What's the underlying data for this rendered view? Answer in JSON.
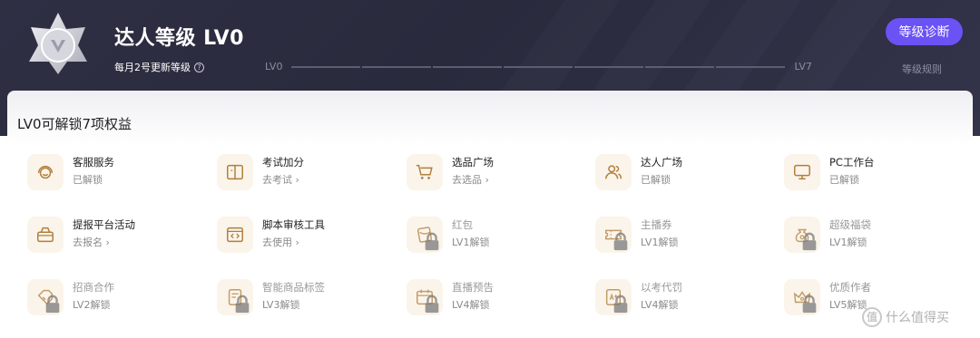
{
  "header": {
    "title": "达人等级 LV0",
    "update_note": "每月2号更新等级",
    "progress": {
      "start_label": "LV0",
      "end_label": "LV7",
      "segments": 7,
      "filled": 0
    },
    "diagnose_button": "等级诊断",
    "rules_link": "等级规则",
    "accent_color": "#6a52f5",
    "background_color": "#2c2c40"
  },
  "panel": {
    "title": "LV0可解锁7项权益"
  },
  "benefits": [
    {
      "name": "客服服务",
      "status": "已解锁",
      "icon": "headset-icon",
      "locked": false,
      "arrow": false
    },
    {
      "name": "考试加分",
      "status": "去考试",
      "icon": "book-icon",
      "locked": false,
      "arrow": true
    },
    {
      "name": "选品广场",
      "status": "去选品",
      "icon": "cart-icon",
      "locked": false,
      "arrow": true
    },
    {
      "name": "达人广场",
      "status": "已解锁",
      "icon": "users-icon",
      "locked": false,
      "arrow": false
    },
    {
      "name": "PC工作台",
      "status": "已解锁",
      "icon": "monitor-icon",
      "locked": false,
      "arrow": false
    },
    {
      "name": "提报平台活动",
      "status": "去报名",
      "icon": "basket-icon",
      "locked": false,
      "arrow": true
    },
    {
      "name": "脚本审核工具",
      "status": "去使用",
      "icon": "code-window-icon",
      "locked": false,
      "arrow": true
    },
    {
      "name": "红包",
      "status": "LV1解锁",
      "icon": "red-packet-icon",
      "locked": true,
      "arrow": false
    },
    {
      "name": "主播券",
      "status": "LV1解锁",
      "icon": "ticket-icon",
      "locked": true,
      "arrow": false
    },
    {
      "name": "超级福袋",
      "status": "LV1解锁",
      "icon": "lucky-bag-icon",
      "locked": true,
      "arrow": false
    },
    {
      "name": "招商合作",
      "status": "LV2解锁",
      "icon": "tag-icon",
      "locked": true,
      "arrow": false
    },
    {
      "name": "智能商品标签",
      "status": "LV3解锁",
      "icon": "label-icon",
      "locked": true,
      "arrow": false
    },
    {
      "name": "直播预告",
      "status": "LV4解锁",
      "icon": "calendar-icon",
      "locked": true,
      "arrow": false
    },
    {
      "name": "以考代罚",
      "status": "LV4解锁",
      "icon": "exam-icon",
      "locked": true,
      "arrow": false
    },
    {
      "name": "优质作者",
      "status": "LV5解锁",
      "icon": "crown-icon",
      "locked": true,
      "arrow": false
    }
  ],
  "watermark": {
    "text": "什么值得买",
    "glyph": "值"
  }
}
